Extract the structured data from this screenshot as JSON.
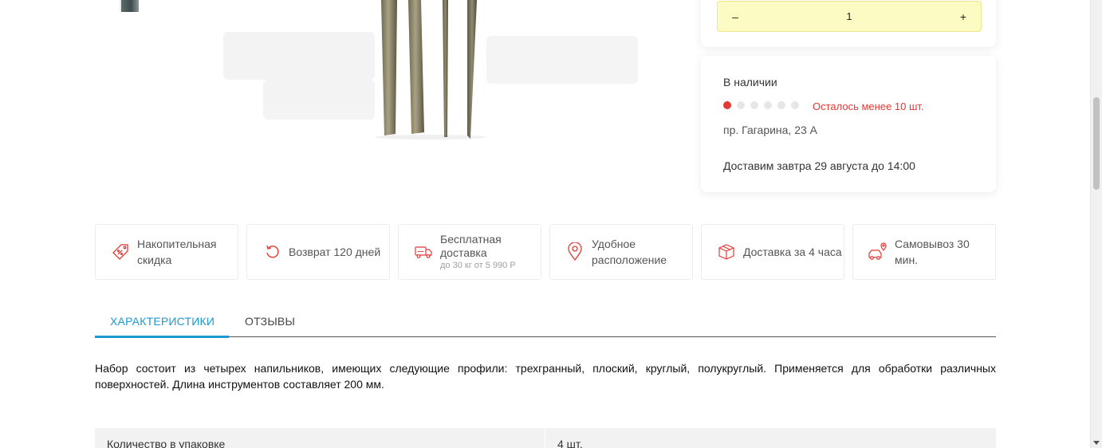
{
  "quantity": {
    "minus_label": "–",
    "value": "1",
    "plus_label": "+"
  },
  "stock": {
    "title": "В наличии",
    "level": 1,
    "level_max": 6,
    "remaining_text": "Осталось менее 10 шт.",
    "address": "пр. Гагарина, 23 А",
    "delivery": "Доставим завтра 29 августа до 14:00",
    "accent_color": "#e53935"
  },
  "features": [
    {
      "icon": "discount-tag-icon",
      "label": "Накопительная скидка",
      "sub": ""
    },
    {
      "icon": "return-arrow-icon",
      "label": "Возврат 120 дней",
      "sub": ""
    },
    {
      "icon": "free-delivery-truck-icon",
      "label": "Бесплатная доставка",
      "sub": "до 30 кг от 5 990 Р"
    },
    {
      "icon": "location-pin-icon",
      "label": "Удобное расположение",
      "sub": ""
    },
    {
      "icon": "package-box-icon",
      "label": "Доставка за 4 часа",
      "sub": ""
    },
    {
      "icon": "car-pickup-icon",
      "label": "Самовывоз 30 мин.",
      "sub": ""
    }
  ],
  "feature_icon_color": "#e53935",
  "tabs": [
    {
      "label": "ХАРАКТЕРИСТИКИ",
      "active": true
    },
    {
      "label": "ОТЗЫВЫ",
      "active": false
    }
  ],
  "tab_active_color": "#1e98d3",
  "description": "Набор состоит из четырех напильников, имеющих следующие профили: трехгранный, плоский, круглый, полукруглый. Применяется для обработки различных поверхностей. Длина инструментов составляет 200 мм.",
  "specs": [
    {
      "name": "Количество в упаковке",
      "value": "4 шт."
    }
  ]
}
